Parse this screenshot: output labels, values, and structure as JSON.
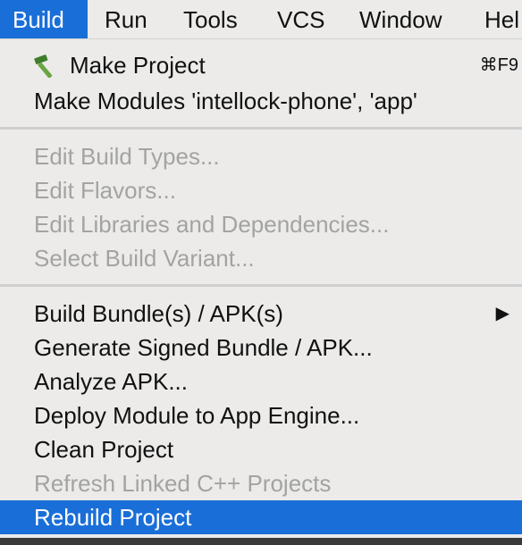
{
  "menubar": {
    "items": [
      {
        "label": "Build",
        "active": true
      },
      {
        "label": "Run"
      },
      {
        "label": "Tools"
      },
      {
        "label": "VCS"
      },
      {
        "label": "Window"
      },
      {
        "label": "Hel"
      }
    ]
  },
  "build_menu": {
    "make_project": {
      "label": "Make Project",
      "shortcut": "⌘F9",
      "icon": "hammer-icon"
    },
    "make_modules": {
      "label": "Make Modules 'intellock-phone', 'app'"
    },
    "edit_build_types": {
      "label": "Edit Build Types...",
      "enabled": false
    },
    "edit_flavors": {
      "label": "Edit Flavors...",
      "enabled": false
    },
    "edit_libraries": {
      "label": "Edit Libraries and Dependencies...",
      "enabled": false
    },
    "select_build_variant": {
      "label": "Select Build Variant...",
      "enabled": false
    },
    "build_bundles": {
      "label": "Build Bundle(s) / APK(s)",
      "submenu_icon": "triangle-right-icon"
    },
    "generate_signed": {
      "label": "Generate Signed Bundle / APK..."
    },
    "analyze_apk": {
      "label": "Analyze APK..."
    },
    "deploy_module": {
      "label": "Deploy Module to App Engine..."
    },
    "clean_project": {
      "label": "Clean Project"
    },
    "refresh_linked": {
      "label": "Refresh Linked C++ Projects",
      "enabled": false
    },
    "rebuild_project": {
      "label": "Rebuild Project",
      "highlighted": true
    }
  },
  "colors": {
    "menu_background": "#ecebea",
    "highlight": "#1a6ed8",
    "disabled_text": "#a3a3a3",
    "text": "#111111"
  }
}
